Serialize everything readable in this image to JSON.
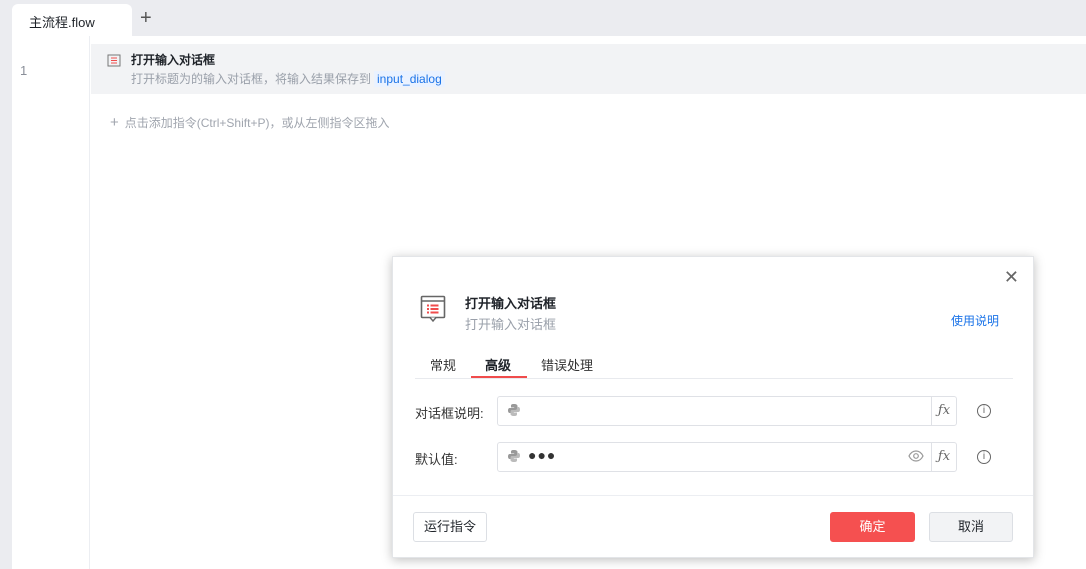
{
  "tabs": {
    "active": "主流程.flow",
    "add": "+"
  },
  "editor": {
    "line_number": "1",
    "step": {
      "title": "打开输入对话框",
      "desc": "打开标题为的输入对话框，将输入结果保存到",
      "variable": "input_dialog"
    },
    "add_hint": "点击添加指令(Ctrl+Shift+P)，或从左侧指令区拖入"
  },
  "dialog": {
    "title": "打开输入对话框",
    "subtitle": "打开输入对话框",
    "help": "使用说明",
    "tabs": [
      "常规",
      "高级",
      "错误处理"
    ],
    "active_tab": "高级",
    "fields": [
      {
        "label": "对话框说明:",
        "value": ""
      },
      {
        "label": "默认值:",
        "value": "●●●"
      }
    ],
    "fx": "ƒx",
    "info": "i",
    "buttons": {
      "run": "运行指令",
      "ok": "确定",
      "cancel": "取消"
    },
    "colors": {
      "accent": "#f55050",
      "link": "#1a73e8"
    }
  }
}
